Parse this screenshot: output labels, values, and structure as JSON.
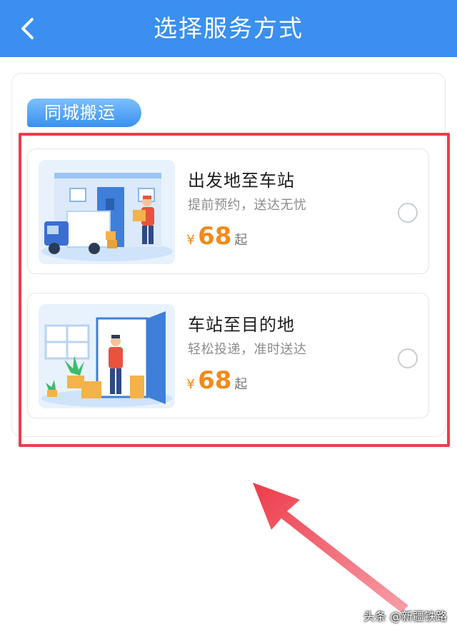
{
  "header": {
    "title": "选择服务方式",
    "back_icon": "chevron-left-icon"
  },
  "section": {
    "label": "同城搬运"
  },
  "options": [
    {
      "title": "出发地至车站",
      "subtitle": "提前预约，送达无忧",
      "currency": "¥",
      "price": "68",
      "price_suffix": "起",
      "selected": false,
      "illustration": "moving-truck-illustration"
    },
    {
      "title": "车站至目的地",
      "subtitle": "轻松投递，准时送达",
      "currency": "¥",
      "price": "68",
      "price_suffix": "起",
      "selected": false,
      "illustration": "door-delivery-illustration"
    }
  ],
  "watermark": "头条 @新疆铁路",
  "colors": {
    "header_bg": "#3a8ff0",
    "price": "#f08b1e",
    "highlight": "#ee3b4b"
  }
}
